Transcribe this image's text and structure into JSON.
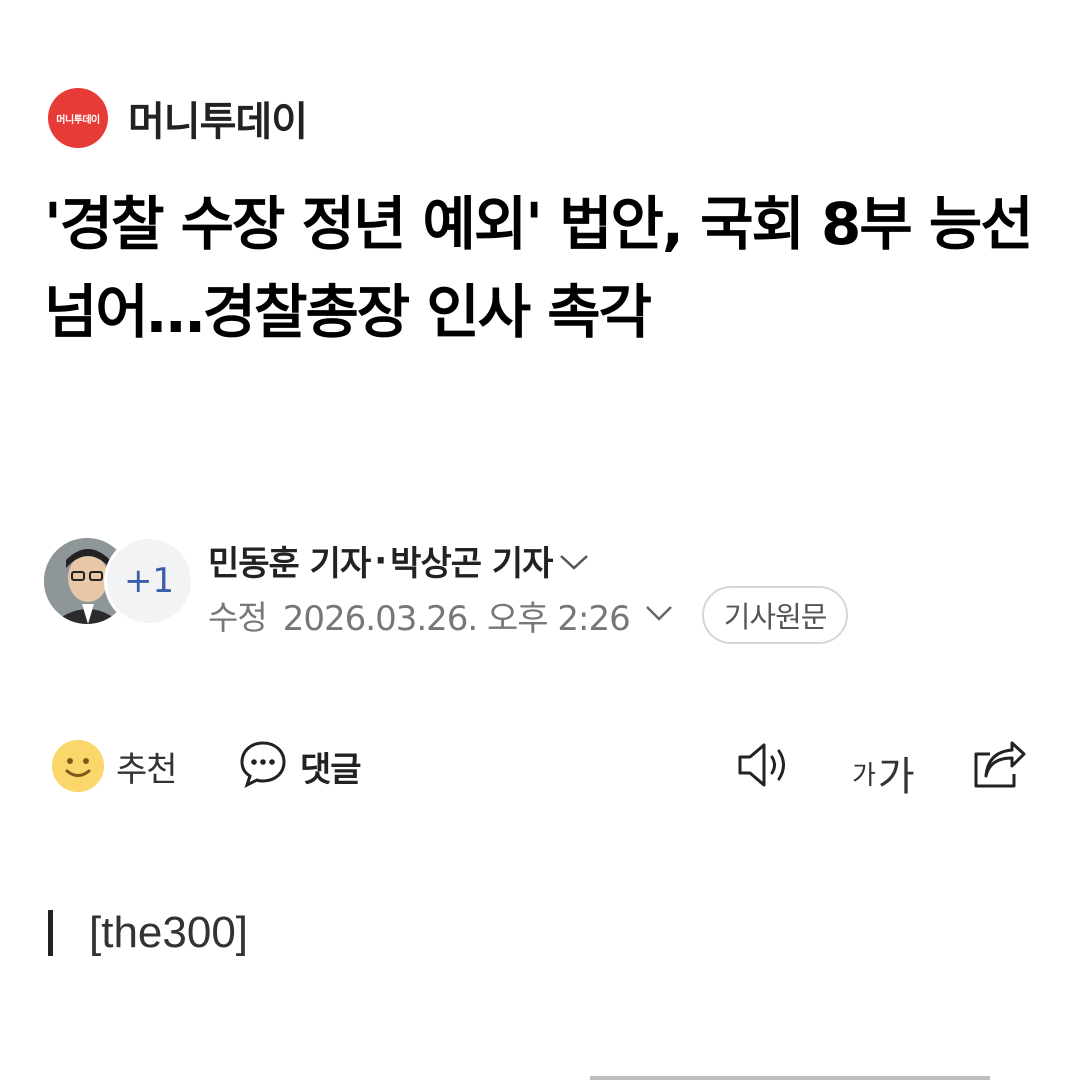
{
  "publisher": {
    "logo_text": "머니투데이",
    "name": "머니투데이",
    "logo_color": "#e63b37"
  },
  "article": {
    "headline": "'경찰 수장 정년 예외' 법안, 국회 8부 능선 넘어…경찰총장 인사 촉각",
    "section": "[the300]"
  },
  "byline": {
    "extra_authors": "+1",
    "author_1": "민동훈 기자",
    "separator": "·",
    "author_2": "박상곤 기자",
    "date_label": "수정",
    "date_value": "2026.03.26. 오후 2:26",
    "original_button": "기사원문"
  },
  "actions": {
    "recommend_label": "추천",
    "comment_label": "댓글",
    "font_small": "가",
    "font_big": "가"
  },
  "icons": [
    "chevron-down-icon",
    "smile-icon",
    "comment-icon",
    "speaker-icon",
    "font-size-icon",
    "share-icon"
  ],
  "colors": {
    "accent": "#e63b37",
    "badge_text": "#3b5fa8",
    "smile": "#fbd66a"
  }
}
